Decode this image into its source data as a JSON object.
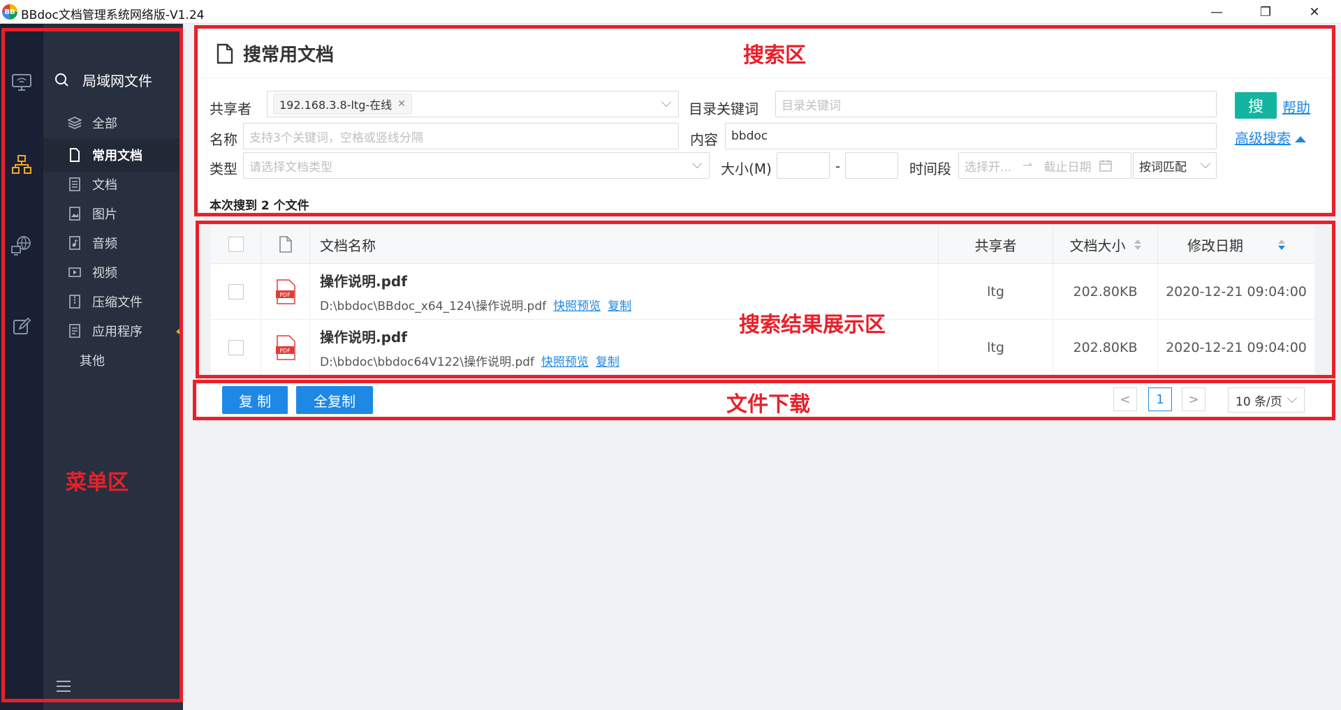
{
  "window": {
    "logo_text": "BB",
    "title": "BBdoc文档管理系统网络版-V1.24",
    "controls": [
      "—",
      "❐",
      "✕"
    ]
  },
  "menu": {
    "heading": "局域网文件",
    "items": [
      {
        "label": "全部",
        "icon": "layers-icon"
      },
      {
        "label": "常用文档",
        "icon": "document-icon",
        "active": true
      },
      {
        "label": "文档",
        "icon": "text-file-icon"
      },
      {
        "label": "图片",
        "icon": "image-file-icon"
      },
      {
        "label": "音频",
        "icon": "audio-file-icon"
      },
      {
        "label": "视频",
        "icon": "video-file-icon"
      },
      {
        "label": "压缩文件",
        "icon": "archive-file-icon"
      },
      {
        "label": "应用程序",
        "icon": "app-file-icon"
      },
      {
        "label": "其他"
      }
    ]
  },
  "search": {
    "title": "搜常用文档",
    "sharer_label": "共享者",
    "sharer_tag": "192.168.3.8-ltg-在线",
    "dir_keyword_label": "目录关键词",
    "dir_keyword_placeholder": "目录关键词",
    "name_label": "名称",
    "name_placeholder": "支持3个关键词，空格或竖线分隔",
    "content_label": "内容",
    "content_value": "bbdoc",
    "type_label": "类型",
    "type_placeholder": "请选择文档类型",
    "size_label": "大小(M)",
    "size_sep": "-",
    "period_label": "时间段",
    "start_placeholder": "选择开...",
    "end_placeholder": "截止日期",
    "match_mode": "按词匹配",
    "search_button": "搜",
    "help_link": "帮助",
    "advanced_link": "高级搜索",
    "result_count": "本次搜到 2 个文件"
  },
  "results": {
    "columns": {
      "name": "文档名称",
      "sharer": "共享者",
      "size": "文档大小",
      "date": "修改日期"
    },
    "rows": [
      {
        "name": "操作说明.pdf",
        "path": "D:\\bbdoc\\BBdoc_x64_124\\操作说明.pdf",
        "preview": "快照预览",
        "copy": "复制",
        "sharer": "ltg",
        "size": "202.80KB",
        "date": "2020-12-21 09:04:00",
        "icon_text": "PDF"
      },
      {
        "name": "操作说明.pdf",
        "path": "D:\\bbdoc\\bbdoc64V122\\操作说明.pdf",
        "preview": "快照预览",
        "copy": "复制",
        "sharer": "ltg",
        "size": "202.80KB",
        "date": "2020-12-21 09:04:00",
        "icon_text": "PDF"
      }
    ]
  },
  "footer": {
    "copy_button": "复 制",
    "copy_all_button": "全复制",
    "prev": "<",
    "current_page": "1",
    "next": ">",
    "page_size": "10 条/页"
  },
  "annotations": {
    "search_area": "搜索区",
    "results_area": "搜索结果展示区",
    "download_area": "文件下载",
    "menu_area": "菜单区"
  },
  "colors": {
    "accent": "#1e88e5",
    "search_btn": "#13b5a0",
    "annotation": "#e8202a",
    "sidebar": "#28303f",
    "iconbar": "#192033"
  }
}
